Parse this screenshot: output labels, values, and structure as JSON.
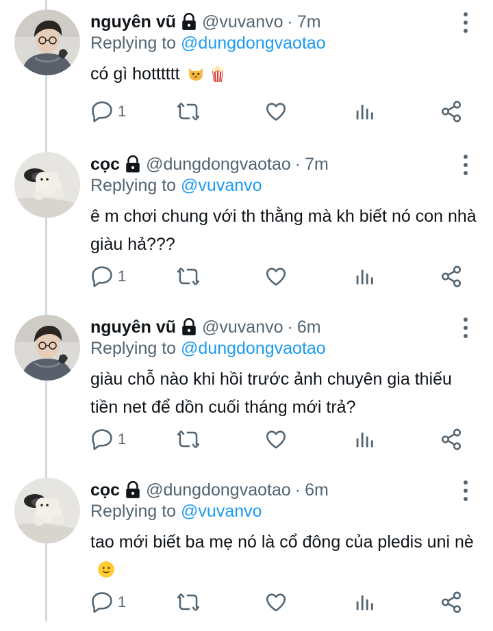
{
  "colors": {
    "text": "#0f1419",
    "muted": "#536471",
    "accent": "#1d9bf0",
    "thread_line": "#cfd9de"
  },
  "tweets": [
    {
      "name": "nguyên vũ",
      "handle": "@vuvanvo",
      "separator": "·",
      "time": "7m",
      "reply_prefix": "Replying to",
      "reply_to": "@dungdongvaotao",
      "text": "có gì hotttttt",
      "emojis": [
        "cat-emoji",
        "popcorn-emoji"
      ],
      "reply_count": "1",
      "avatar": "boy-avatar"
    },
    {
      "name": "cọc",
      "handle": "@dungdongvaotao",
      "separator": "·",
      "time": "7m",
      "reply_prefix": "Replying to",
      "reply_to": "@vuvanvo",
      "text": "ê m chơi chung với th thằng mà kh biết nó con nhà giàu hả???",
      "emojis": [],
      "reply_count": "1",
      "avatar": "plush-avatar"
    },
    {
      "name": "nguyên vũ",
      "handle": "@vuvanvo",
      "separator": "·",
      "time": "6m",
      "reply_prefix": "Replying to",
      "reply_to": "@dungdongvaotao",
      "text": "giàu chỗ nào khi hồi trước ảnh chuyên gia thiếu tiền net để dồn cuối tháng mới trả?",
      "emojis": [],
      "reply_count": "1",
      "avatar": "boy-avatar"
    },
    {
      "name": "cọc",
      "handle": "@dungdongvaotao",
      "separator": "·",
      "time": "6m",
      "reply_prefix": "Replying to",
      "reply_to": "@vuvanvo",
      "text": "tao mới biết ba mẹ nó là cổ đông của pledis uni nè",
      "emojis": [
        "slightly-smiling-emoji"
      ],
      "reply_count": "1",
      "avatar": "plush-avatar"
    }
  ]
}
